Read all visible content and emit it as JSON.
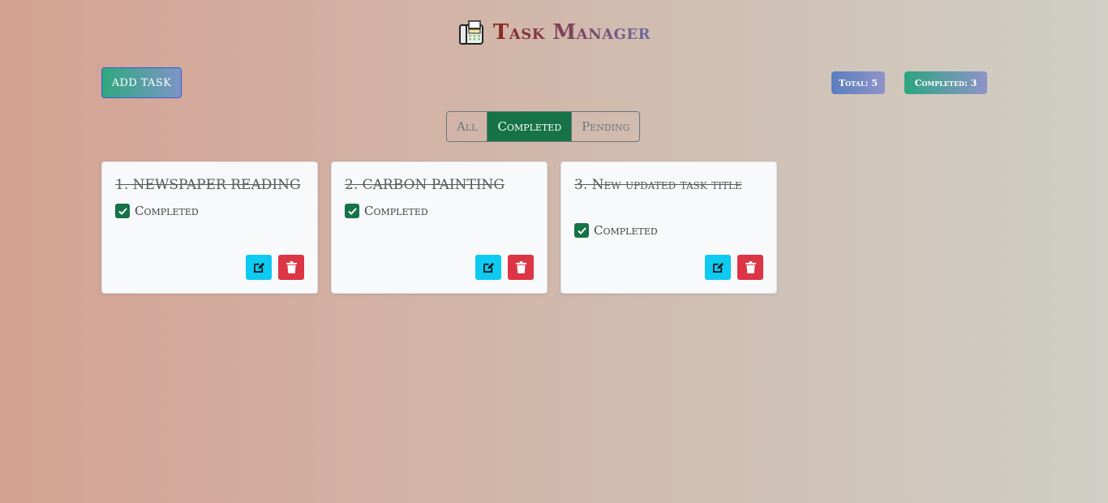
{
  "header": {
    "title": "Task Manager",
    "icon": "fax-icon"
  },
  "toolbar": {
    "add_label": "ADD TASK"
  },
  "stats": {
    "total": "Total: 5",
    "completed": "Completed: 3"
  },
  "filters": [
    {
      "label": "All",
      "active": false
    },
    {
      "label": "Completed",
      "active": true
    },
    {
      "label": "Pending",
      "active": false
    }
  ],
  "tasks": [
    {
      "title": "1. NEWSPAPER READING",
      "status": "Completed"
    },
    {
      "title": "2. CARBON PAINTING",
      "status": "Completed"
    },
    {
      "title": "3. New updated task title",
      "status": "Completed"
    }
  ],
  "colors": {
    "accent_green": "#157347",
    "edit": "#0dcaf0",
    "delete": "#dc3545"
  }
}
